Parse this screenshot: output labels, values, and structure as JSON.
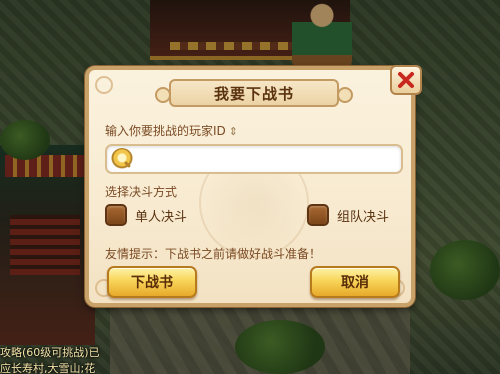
{
  "dialog": {
    "title": "我要下战书",
    "input_prompt": "输入你要挑战的玩家ID",
    "input_value": "",
    "input_placeholder": "",
    "mode_label": "选择决斗方式",
    "options": [
      {
        "label": "单人决斗",
        "checked": false
      },
      {
        "label": "组队决斗",
        "checked": false
      }
    ],
    "tip": "友情提示：下战书之前请做好战斗准备！",
    "confirm_label": "下战书",
    "cancel_label": "取消"
  },
  "background": {
    "chat_line_1": "攻略(60级可挑战)已",
    "chat_line_2": "应长寿村,大雪山;花"
  },
  "colors": {
    "panel": "#f7ead0",
    "panel_border": "#c9a26a",
    "text_brown": "#7a4a24",
    "button_gold": "#f7d55a",
    "close_red": "#c8281e",
    "checkbox_brown": "#8b5426"
  },
  "icons": {
    "close": "close-icon",
    "search": "search-icon",
    "swap": "swap-icon"
  }
}
